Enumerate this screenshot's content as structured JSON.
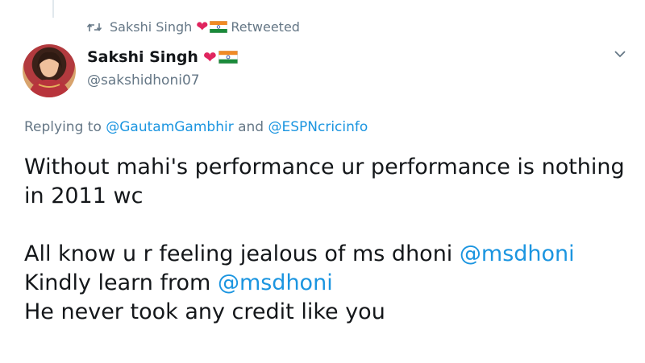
{
  "retweet": {
    "user": "Sakshi Singh",
    "suffix": "Retweeted"
  },
  "author": {
    "display_name": "Sakshi Singh",
    "handle": "@sakshidhoni07",
    "emoji": [
      "red-heart",
      "india-flag"
    ]
  },
  "reply": {
    "prefix": "Replying to",
    "user1": "@GautamGambhir",
    "conjunction": "and",
    "user2": "@ESPNcricinfo"
  },
  "tweet": {
    "para1_line1": "Without mahi's performance ur performance is nothing",
    "para1_line2": "in 2011 wc",
    "para2_line1_text": "All know u r feeling jealous of ms dhoni",
    "para2_line1_mention": "@msdhoni",
    "para2_line2_text": "Kindly learn from",
    "para2_line2_mention": "@msdhoni",
    "para2_line3": "He never took any credit like you"
  },
  "colors": {
    "link": "#1b95e0",
    "secondary_text": "#657786",
    "heart": "#e0245e"
  },
  "icons": {
    "retweet": "retweet-icon",
    "caret": "chevron-down-icon"
  }
}
